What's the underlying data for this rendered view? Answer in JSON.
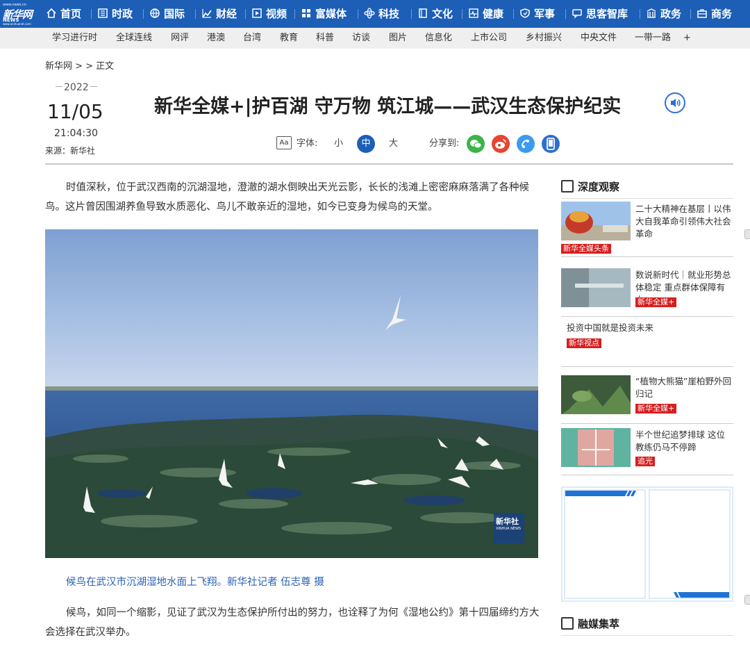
{
  "logo": {
    "small": "www.news.cn",
    "text": "新华网",
    "sub": "NEWS",
    "url_text": "www.xinhuanet.com"
  },
  "nav": [
    {
      "label": "首页",
      "icon": "home-icon"
    },
    {
      "label": "时政",
      "icon": "building-icon"
    },
    {
      "label": "国际",
      "icon": "globe-icon"
    },
    {
      "label": "财经",
      "icon": "chart-icon"
    },
    {
      "label": "视频",
      "icon": "play-icon"
    },
    {
      "label": "富媒体",
      "icon": "grid-icon"
    },
    {
      "label": "科技",
      "icon": "atom-icon"
    },
    {
      "label": "文化",
      "icon": "book-icon"
    },
    {
      "label": "健康",
      "icon": "heartbeat-icon"
    },
    {
      "label": "军事",
      "icon": "shield-icon"
    },
    {
      "label": "思客智库",
      "icon": "chat-icon"
    },
    {
      "label": "政务",
      "icon": "gov-icon"
    },
    {
      "label": "商务",
      "icon": "briefcase-icon"
    }
  ],
  "subnav": [
    "学习进行时",
    "全球连线",
    "网评",
    "港澳",
    "台湾",
    "教育",
    "科普",
    "访谈",
    "图片",
    "信息化",
    "上市公司",
    "乡村振兴",
    "中央文件",
    "一带一路",
    "+"
  ],
  "breadcrumb": "新华网 > > 正文",
  "date": {
    "year": "2022",
    "month_day": "11/05",
    "time": "21:04:30",
    "source": "来源：新华社"
  },
  "title": "新华全媒+|护百湖 守万物 筑江城——武汉生态保护纪实",
  "tools": {
    "font_label": "字体:",
    "small": "小",
    "medium": "中",
    "large": "大",
    "share_label": "分享到:"
  },
  "share": [
    {
      "name": "wechat",
      "color": "#3bb44a"
    },
    {
      "name": "weibo",
      "color": "#e6452f"
    },
    {
      "name": "link",
      "color": "#3a9bef"
    },
    {
      "name": "mobile",
      "color": "#2d6ed4"
    }
  ],
  "article": {
    "p1": "时值深秋，位于武汉西南的沉湖湿地，澄澈的湖水倒映出天光云影，长长的浅滩上密密麻麻落满了各种候鸟。这片曾因围湖养鱼导致水质恶化、鸟儿不敢亲近的湿地，如今已变身为候鸟的天堂。",
    "caption": "候鸟在武汉市沉湖湿地水面上飞翔。新华社记者 伍志尊 摄",
    "p2": "候鸟，如同一个缩影，见证了武汉为生态保护所付出的努力，也诠释了为何《湿地公约》第十四届缔约方大会选择在武汉举办。",
    "watermark": "新华社",
    "watermark_sub": "XINHUA NEWS"
  },
  "sidebar": {
    "section1": "深度观察",
    "cards": [
      {
        "text": "二十大精神在基层丨以伟大自我革命引领伟大社会革命",
        "tag": "新华全媒头条"
      },
      {
        "text": "数说新时代｜就业形势总体稳定 重点群体保障有力",
        "tag": "新华全媒+"
      },
      {
        "text": "投资中国就是投资未来",
        "tag": "新华视点"
      },
      {
        "text": "“植物大熊猫”崖柏野外回归记",
        "tag": "新华全媒+"
      },
      {
        "text": "半个世纪追梦排球 这位教练仍马不停蹄",
        "tag": "追光"
      }
    ],
    "section2": "融媒集萃"
  }
}
